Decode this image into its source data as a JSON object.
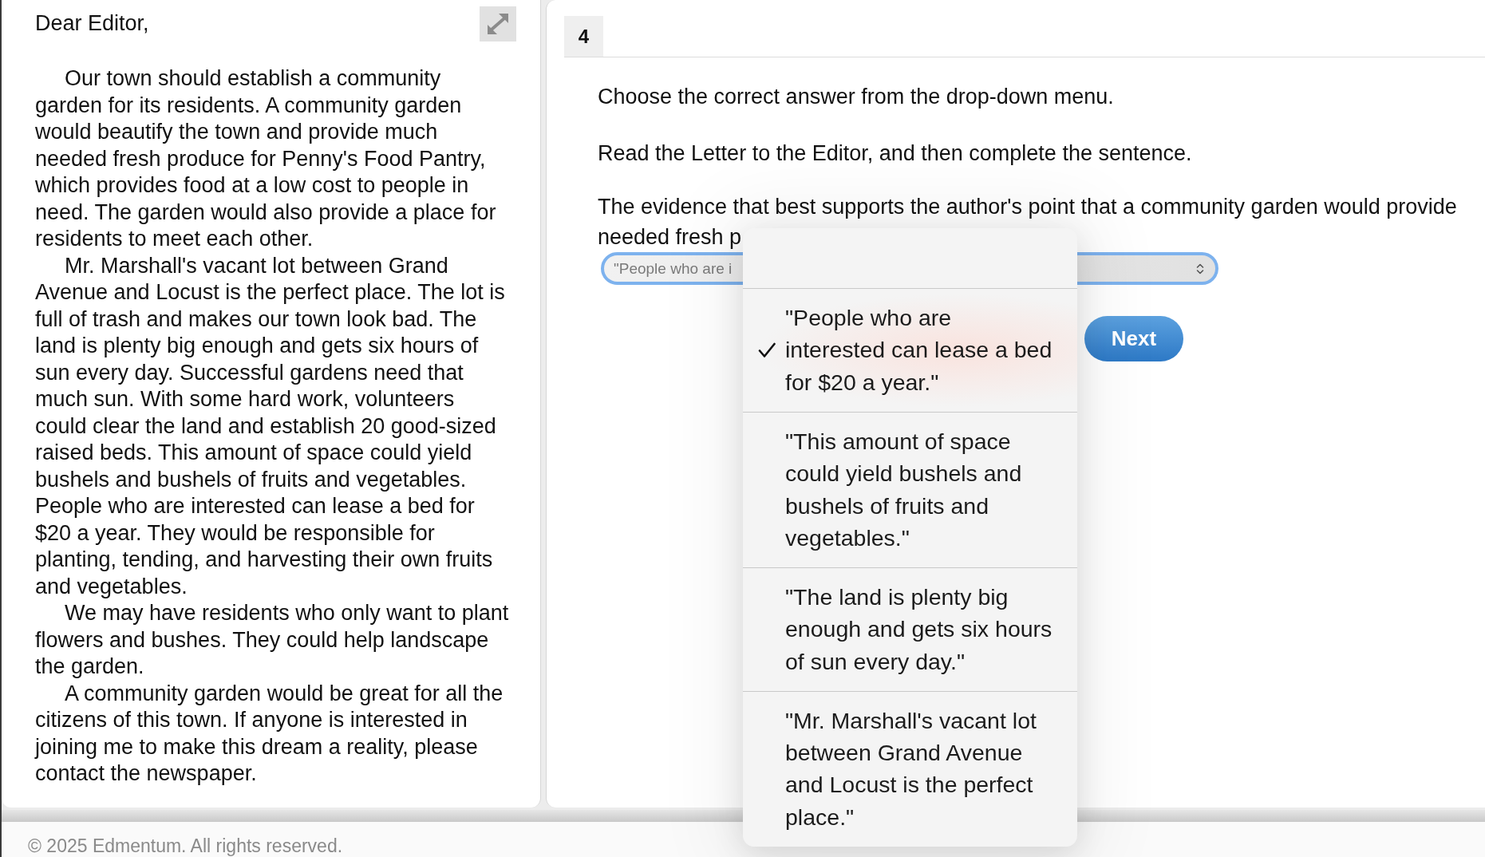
{
  "letter": {
    "salutation": "Dear Editor,",
    "paragraphs": [
      "Our town should establish a community\ngarden for its residents. A community garden\nwould beautify the town and provide much\nneeded fresh produce for Penny's Food Pantry,\nwhich provides food at a low cost to people in\nneed. The garden would also provide a place for\nresidents to meet each other.",
      "Mr. Marshall's vacant lot between Grand\nAvenue and Locust is the perfect place. The lot is\nfull of trash and makes our town look bad. The\nland is plenty big enough and gets six hours of\nsun every day. Successful gardens need that\nmuch sun. With some hard work, volunteers\ncould clear the land and establish 20 good-sized\nraised beds. This amount of space could yield\nbushels and bushels of fruits and vegetables.\nPeople who are interested can lease a bed for\n$20 a year. They would be responsible for\nplanting, tending, and harvesting their own fruits\nand vegetables.",
      "We may have residents who only want to plant\nflowers and bushes. They could help landscape\nthe garden.",
      "A community garden would be great for all the\ncitizens of this town. If anyone is interested in\njoining me to make this dream a reality, please\ncontact the newspaper."
    ]
  },
  "question": {
    "number": "4",
    "instructions": [
      "Choose the correct answer from the drop-down menu.",
      "Read the Letter to the Editor, and then complete the sentence."
    ],
    "prompt": "The evidence that best supports the author's point that a community garden would provide needed fresh p",
    "dropdown": {
      "value": "\"People who are i",
      "expanded": true,
      "options": [
        {
          "label": "\"People who are interested can lease a bed for $20 a year.\"",
          "selected": true
        },
        {
          "label": "\"This amount of space could yield bushels and bushels of fruits and vegetables.\"",
          "selected": false
        },
        {
          "label": "\"The land is plenty big enough and gets six hours of sun every day.\"",
          "selected": false
        },
        {
          "label": "\"Mr. Marshall's vacant lot between Grand Avenue and Locust is the perfect place.\"",
          "selected": false
        }
      ]
    },
    "next_button": "Next"
  },
  "footer": "© 2025 Edmentum. All rights reserved."
}
